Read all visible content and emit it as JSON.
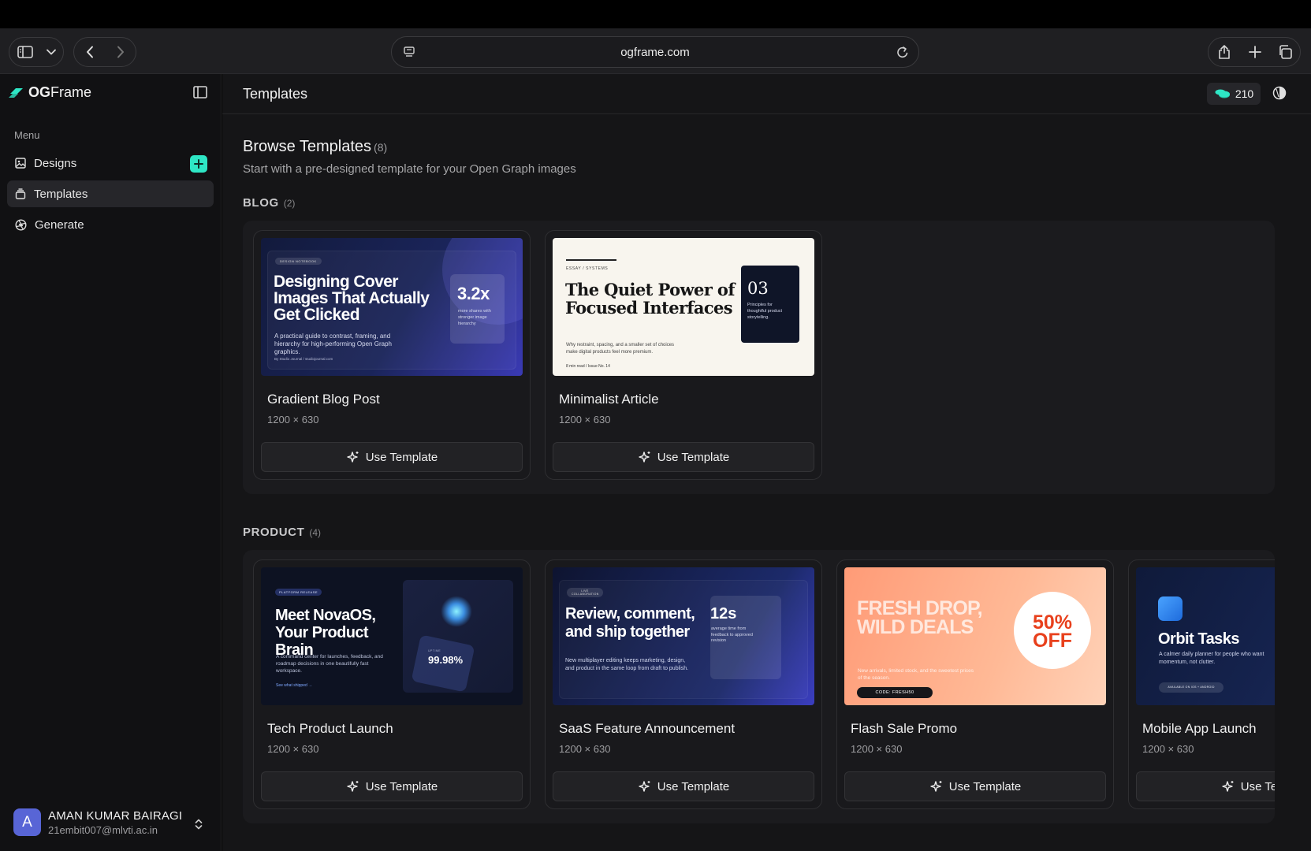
{
  "browser": {
    "url": "ogframe.com"
  },
  "sidebar": {
    "brand_prefix": "OG",
    "brand_suffix": "Frame",
    "menu_label": "Menu",
    "items": [
      {
        "label": "Designs",
        "icon": "image-icon"
      },
      {
        "label": "Templates",
        "icon": "stack-icon",
        "active": true
      },
      {
        "label": "Generate",
        "icon": "aperture-icon"
      }
    ],
    "user": {
      "initial": "A",
      "name": "AMAN KUMAR BAIRAGI",
      "email": "21embit007@mlvti.ac.in"
    }
  },
  "header": {
    "title": "Templates",
    "credits": "210"
  },
  "browse": {
    "title": "Browse Templates",
    "count": "(8)",
    "subtitle": "Start with a pre-designed template for your Open Graph images"
  },
  "sections": [
    {
      "title": "BLOG",
      "count": "(2)",
      "cards": [
        {
          "name": "Gradient Blog Post",
          "size": "1200 × 630",
          "button": "Use Template",
          "preview": {
            "tag": "DESIGN NOTEBOOK",
            "headline": "Designing Cover Images That Actually Get Clicked",
            "body": "A practical guide to contrast, framing, and hierarchy for high-performing Open Graph graphics.",
            "footer": "By Studio Journal / studiojournal.com",
            "stat": "3.2x",
            "stat_caption": "more shares with stronger image hierarchy"
          }
        },
        {
          "name": "Minimalist Article",
          "size": "1200 × 630",
          "button": "Use Template",
          "preview": {
            "tag": "ESSAY / SYSTEMS",
            "headline": "The Quiet Power of Focused Interfaces",
            "body": "Why restraint, spacing, and a smaller set of choices make digital products feel more premium.",
            "footer": "8 min read / Issue No. 14",
            "stat": "03",
            "stat_caption": "Principles for thoughtful product storytelling."
          }
        }
      ]
    },
    {
      "title": "PRODUCT",
      "count": "(4)",
      "cards": [
        {
          "name": "Tech Product Launch",
          "size": "1200 × 630",
          "button": "Use Template",
          "preview": {
            "tag": "PLATFORM RELEASE",
            "headline": "Meet NovaOS, Your Product Brain",
            "body": "A command center for launches, feedback, and roadmap decisions in one beautifully fast workspace.",
            "link": "See what shipped →",
            "stat_label": "UPTIME",
            "stat": "99.98%"
          }
        },
        {
          "name": "SaaS Feature Announcement",
          "size": "1200 × 630",
          "button": "Use Template",
          "preview": {
            "tag": "LIVE COLLABORATION",
            "headline": "Review, comment, and ship together",
            "body": "New multiplayer editing keeps marketing, design, and product in the same loop from draft to publish.",
            "stat": "12s",
            "stat_caption": "average time from feedback to approved revision"
          }
        },
        {
          "name": "Flash Sale Promo",
          "size": "1200 × 630",
          "button": "Use Template",
          "preview": {
            "headline": "FRESH DROP, WILD DEALS",
            "body": "New arrivals, limited stock, and the sweetest prices of the season.",
            "code": "CODE: FRESH50",
            "badge_top": "50%",
            "badge_bottom": "OFF"
          }
        },
        {
          "name": "Mobile App Launch",
          "size": "1200 × 630",
          "button": "Use Template",
          "preview": {
            "headline": "Orbit Tasks",
            "body": "A calmer daily planner for people who want momentum, not clutter.",
            "store": "AVAILABLE ON IOS + ANDROID"
          }
        }
      ]
    }
  ],
  "colors": {
    "accent": "#2ee6c5",
    "avatar": "#5865d6",
    "sale_red": "#e8401c"
  }
}
